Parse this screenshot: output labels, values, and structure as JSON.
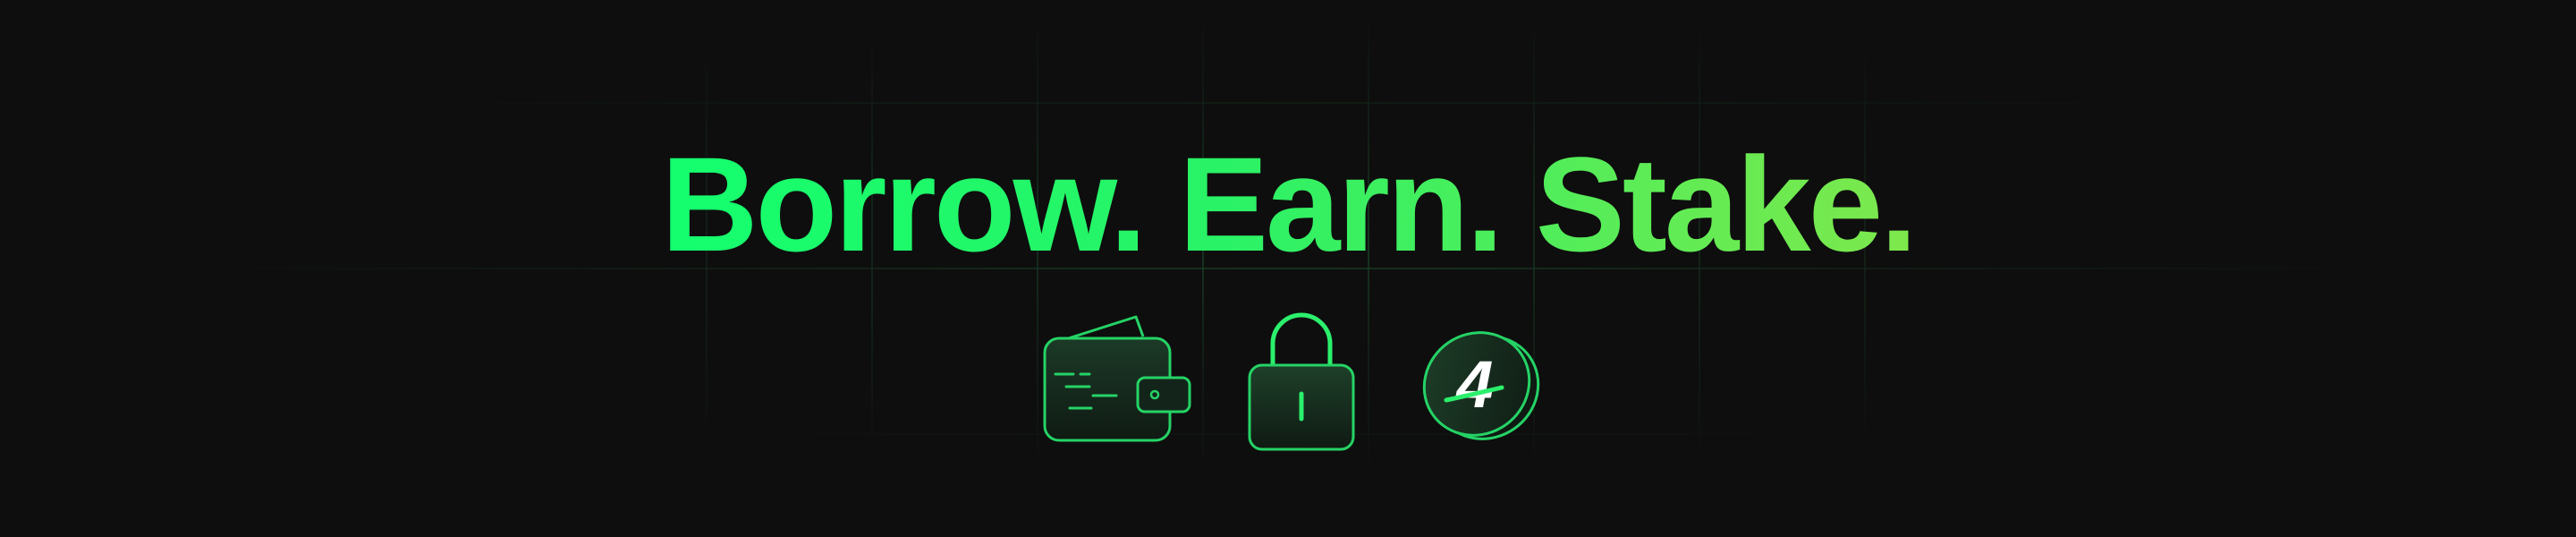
{
  "banner": {
    "headline": "Borrow. Earn. Stake.",
    "icons": [
      {
        "name": "wallet-icon"
      },
      {
        "name": "lock-icon"
      },
      {
        "name": "coin-icon",
        "glyph": "4"
      }
    ]
  },
  "colors": {
    "background": "#0e0e0e",
    "accent_start": "#14ff6e",
    "accent_end": "#7ee84c",
    "icon_stroke": "#25d366",
    "icon_fill": "#162a1e",
    "grid_line": "#1f6b3a"
  }
}
